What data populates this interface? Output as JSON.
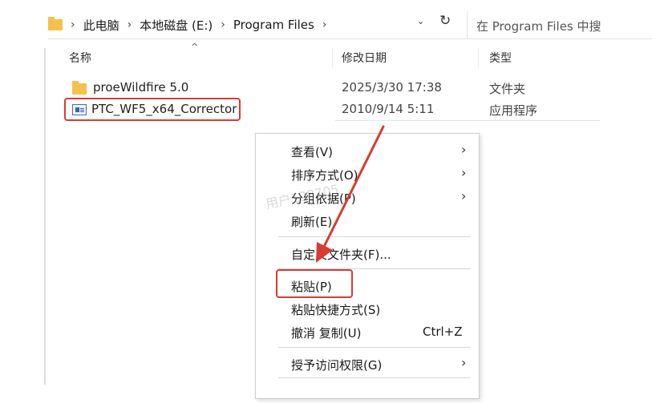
{
  "address": {
    "crumbs": [
      "此电脑",
      "本地磁盘 (E:)",
      "Program Files"
    ],
    "refresh_glyph": "↻",
    "dropdown_glyph": "⌄",
    "search_placeholder": "在 Program Files 中搜"
  },
  "columns": {
    "name": "名称",
    "date": "修改日期",
    "type": "类型"
  },
  "files": [
    {
      "name": "proeWildfire 5.0",
      "date": "2025/3/30 17:38",
      "type": "文件夹",
      "icon": "folder-icon"
    },
    {
      "name": "PTC_WF5_x64_Corrector",
      "date": "2010/9/14 5:11",
      "type": "应用程序",
      "icon": "application-icon"
    }
  ],
  "context_menu": {
    "view": "查看(V)",
    "sort": "排序方式(O)",
    "group": "分组依据(P)",
    "refresh": "刷新(E)",
    "customize": "自定义文件夹(F)...",
    "paste": "粘贴(P)",
    "paste_shortcut": "粘贴快捷方式(S)",
    "undo_copy": "撤消 复制(U)",
    "undo_shortcut": "Ctrl+Z",
    "grant_access": "授予访问权限(G)"
  },
  "watermark": "用户108705",
  "colors": {
    "highlight_border": "#d93a35",
    "folder": "#f4c24a",
    "arrow": "#d93a35"
  }
}
